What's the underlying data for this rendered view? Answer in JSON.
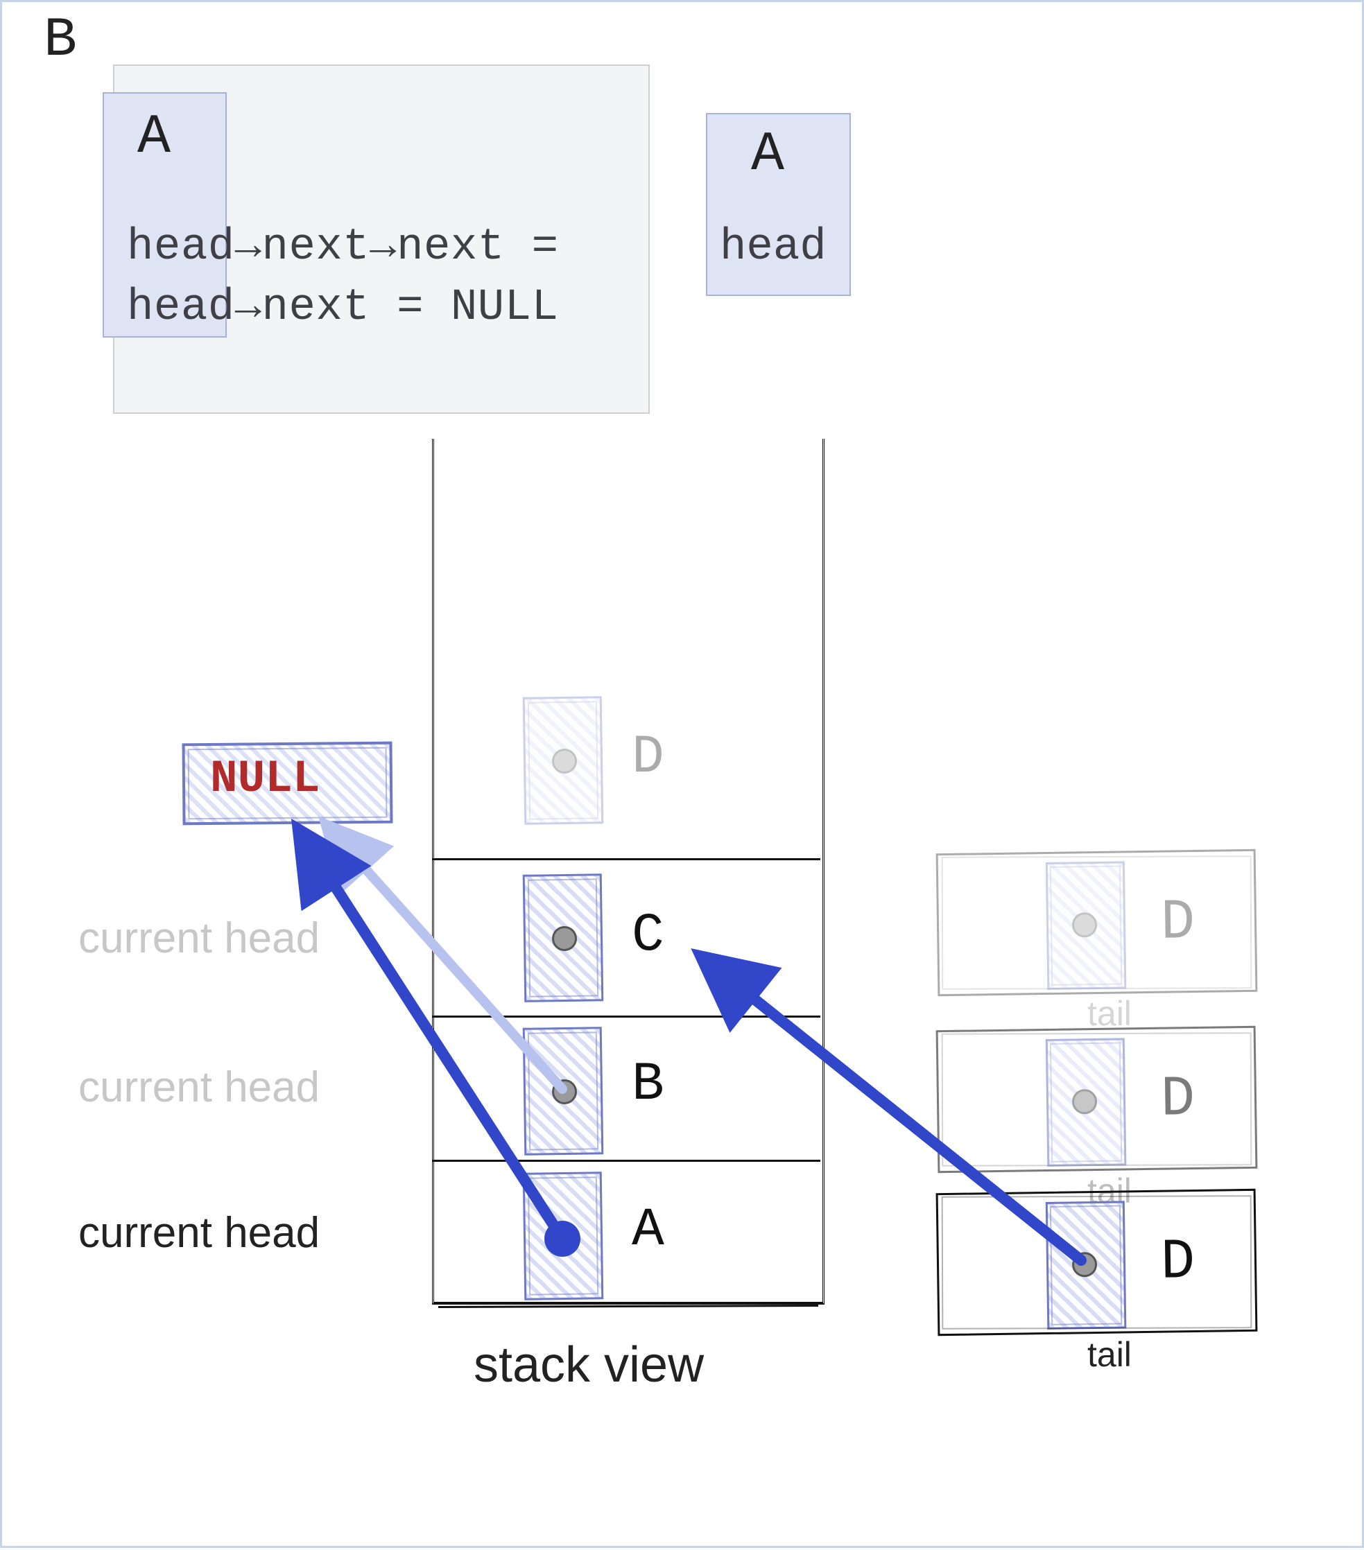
{
  "code_panel": {
    "title": "B",
    "inner_label": "A",
    "line1_text": "head→next→next =",
    "line2_text": "head→next = NULL",
    "right_label": "A",
    "right_head": "head"
  },
  "null_box": {
    "label": "NULL"
  },
  "head_labels": {
    "c": "current head",
    "b": "current head",
    "a": "current head"
  },
  "stack": {
    "caption": "stack view",
    "cells": [
      {
        "letter": "D"
      },
      {
        "letter": "C"
      },
      {
        "letter": "B"
      },
      {
        "letter": "A"
      }
    ]
  },
  "tail": {
    "letters": {
      "d1": "D",
      "d2": "D",
      "d3": "D"
    },
    "labels": {
      "t1": "tail",
      "t2": "tail",
      "t3": "tail"
    }
  }
}
